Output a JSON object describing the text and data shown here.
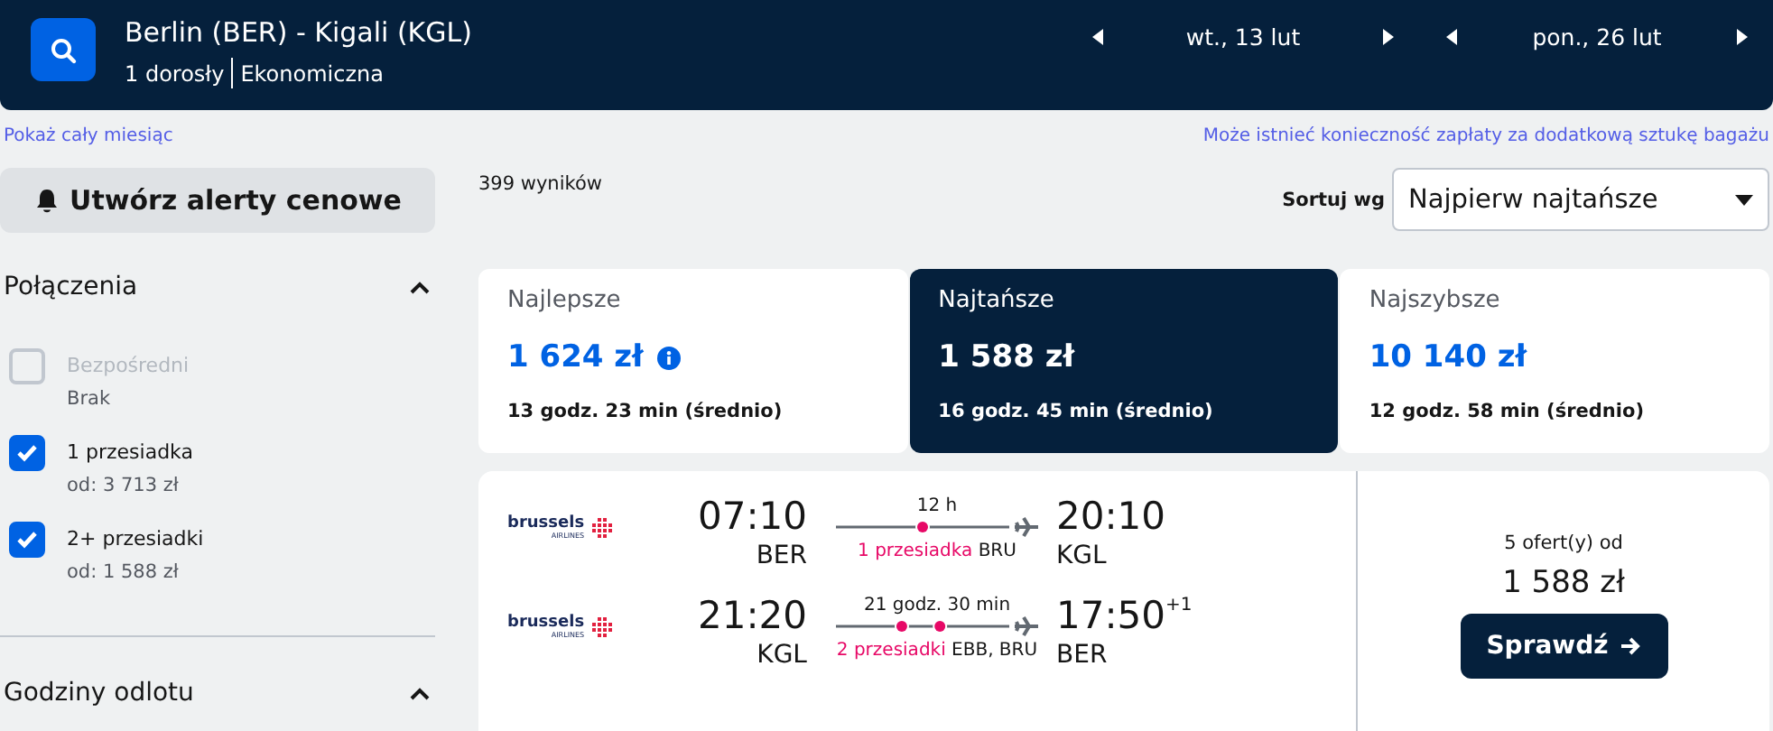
{
  "search": {
    "route": "Berlin (BER) - Kigali (KGL)",
    "passengers": "1 dorosły",
    "cabin": "Ekonomiczna"
  },
  "dates": [
    {
      "label": "wt., 13 lut"
    },
    {
      "label": "pon., 26 lut"
    }
  ],
  "show_month_link": "Pokaż cały miesiąc",
  "baggage_note": "Może istnieć konieczność zapłaty za dodatkową sztukę bagażu",
  "alert_button": "Utwórz alerty cenowe",
  "results_count": "399 wyników",
  "sort": {
    "label": "Sortuj wg",
    "value": "Najpierw najtańsze"
  },
  "filters": [
    {
      "title": "Połączenia",
      "expanded": true,
      "options": [
        {
          "label": "Bezpośredni",
          "sublabel": "Brak",
          "checked": false,
          "disabled": true
        },
        {
          "label": "1 przesiadka",
          "sublabel": "od: 3 713 zł",
          "checked": true,
          "disabled": false
        },
        {
          "label": "2+ przesiadki",
          "sublabel": "od: 1 588 zł",
          "checked": true,
          "disabled": false
        }
      ]
    },
    {
      "title": "Godziny odlotu",
      "expanded": true
    }
  ],
  "tabs": [
    {
      "label": "Najlepsze",
      "price": "1 624 zł",
      "duration": "13 godz. 23 min (średnio)",
      "info": true,
      "selected": false
    },
    {
      "label": "Najtańsze",
      "price": "1 588 zł",
      "duration": "16 godz. 45 min (średnio)",
      "info": false,
      "selected": true
    },
    {
      "label": "Najszybsze",
      "price": "10 140 zł",
      "duration": "12 godz. 58 min (średnio)",
      "info": false,
      "selected": false
    }
  ],
  "result": {
    "legs": [
      {
        "airline": "brussels",
        "airline_sub": "AIRLINES",
        "depart": "07:10",
        "from": "BER",
        "duration": "12 h",
        "kind": "one_stop",
        "stops": "1 przesiadka",
        "via": "BRU",
        "arrive": "20:10",
        "to": "KGL"
      },
      {
        "airline": "brussels",
        "airline_sub": "AIRLINES",
        "depart": "21:20",
        "from": "KGL",
        "duration": "21 godz. 30 min",
        "kind": "two_stops",
        "stops": "2 przesiadki",
        "via": "EBB, BRU",
        "arrive": "17:50",
        "day_offset": "+1",
        "to": "BER"
      }
    ],
    "offers": "5 ofert(y) od",
    "price": "1 588 zł",
    "button": "Sprawdź"
  }
}
